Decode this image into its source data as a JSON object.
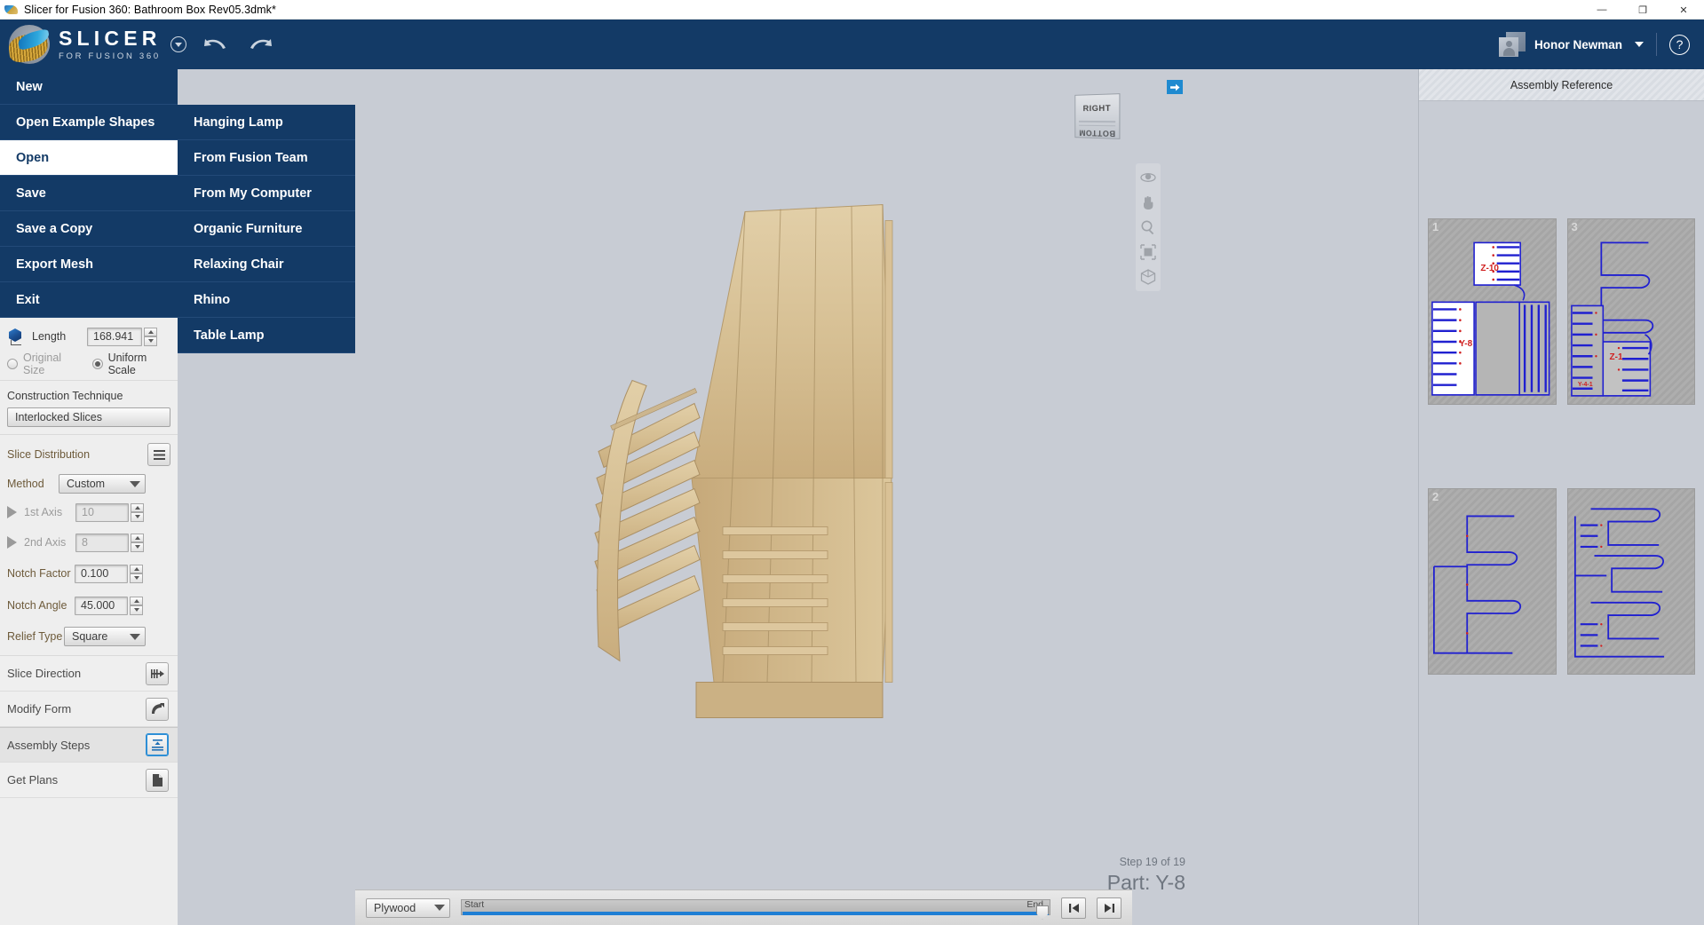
{
  "window": {
    "title": "Slicer for Fusion 360: Bathroom Box Rev05.3dmk*",
    "icon": "slicer-app-icon",
    "minimize": "—",
    "maximize": "❐",
    "close": "✕"
  },
  "header": {
    "brand_main": "SLICER",
    "brand_sub": "FOR FUSION 360",
    "brand_caret": "chevron-down-circle-icon",
    "undo": "undo-arrow-icon",
    "redo": "redo-arrow-icon",
    "user_name": "Honor Newman",
    "user_caret": "chevron-down-icon",
    "help": "?"
  },
  "file_menu": {
    "items": [
      {
        "label": "New",
        "active": false
      },
      {
        "label": "Open Example Shapes",
        "active": false
      },
      {
        "label": "Open",
        "active": true
      },
      {
        "label": "Save",
        "active": false
      },
      {
        "label": "Save a Copy",
        "active": false
      },
      {
        "label": "Export Mesh",
        "active": false
      },
      {
        "label": "Exit",
        "active": false
      }
    ]
  },
  "flyout_menu": {
    "items": [
      {
        "label": "Hanging Lamp"
      },
      {
        "label": "From Fusion Team"
      },
      {
        "label": "From My Computer"
      },
      {
        "label": "Organic Furniture"
      },
      {
        "label": "Relaxing Chair"
      },
      {
        "label": "Rhino"
      },
      {
        "label": "Table Lamp"
      }
    ]
  },
  "params": {
    "length_label": "Length",
    "length_value": "168.941",
    "size_options": [
      {
        "label": "Original Size",
        "selected": false
      },
      {
        "label": "Uniform Scale",
        "selected": true
      }
    ],
    "construction_title": "Construction Technique",
    "construction_value": "Interlocked Slices",
    "slice_distribution_title": "Slice Distribution",
    "slice_distribution_icon": "list-lines-icon",
    "method_label": "Method",
    "method_value": "Custom",
    "axis1_label": "1st Axis",
    "axis1_value": "10",
    "axis2_label": "2nd Axis",
    "axis2_value": "8",
    "notch_factor_label": "Notch Factor",
    "notch_factor_value": "0.100",
    "notch_angle_label": "Notch Angle",
    "notch_angle_value": "45.000",
    "relief_type_label": "Relief Type",
    "relief_type_value": "Square"
  },
  "sections": [
    {
      "label": "Slice Direction",
      "icon": "slice-direction-icon",
      "active": false
    },
    {
      "label": "Modify Form",
      "icon": "modify-form-icon",
      "active": false
    },
    {
      "label": "Assembly Steps",
      "icon": "assembly-steps-icon",
      "active": true
    },
    {
      "label": "Get Plans",
      "icon": "get-plans-icon",
      "active": false
    }
  ],
  "viewport": {
    "viewcube_front": "RIGHT",
    "viewcube_bottom": "BOTTOM",
    "viewcube_expand": "arrow-right-icon",
    "tools": [
      "orbit-icon",
      "pan-hand-icon",
      "zoom-magnifier-icon",
      "fit-view-icon",
      "isometric-cube-icon"
    ],
    "step_text": "Step 19 of 19",
    "part_text": "Part: Y-8"
  },
  "bottom_bar": {
    "material_value": "Plywood",
    "slider_start": "Start",
    "slider_end": "End",
    "first_step_icon": "skip-to-start-icon",
    "last_step_icon": "skip-to-end-icon"
  },
  "right_panel": {
    "title": "Assembly Reference",
    "thumbnails": [
      {
        "number": "1",
        "labels": [
          "Z-10",
          "Y-8"
        ]
      },
      {
        "number": "3",
        "labels": [
          "Z-1",
          "Y-4-1"
        ]
      },
      {
        "number": "2",
        "labels": []
      },
      {
        "number": "",
        "labels": []
      }
    ]
  },
  "colors": {
    "brand_navy": "#133a66",
    "viewport_bg": "#c8ccd4",
    "accent_blue": "#1f7fd4",
    "drawing_blue": "#2020d0",
    "drawing_red": "#d02020"
  }
}
